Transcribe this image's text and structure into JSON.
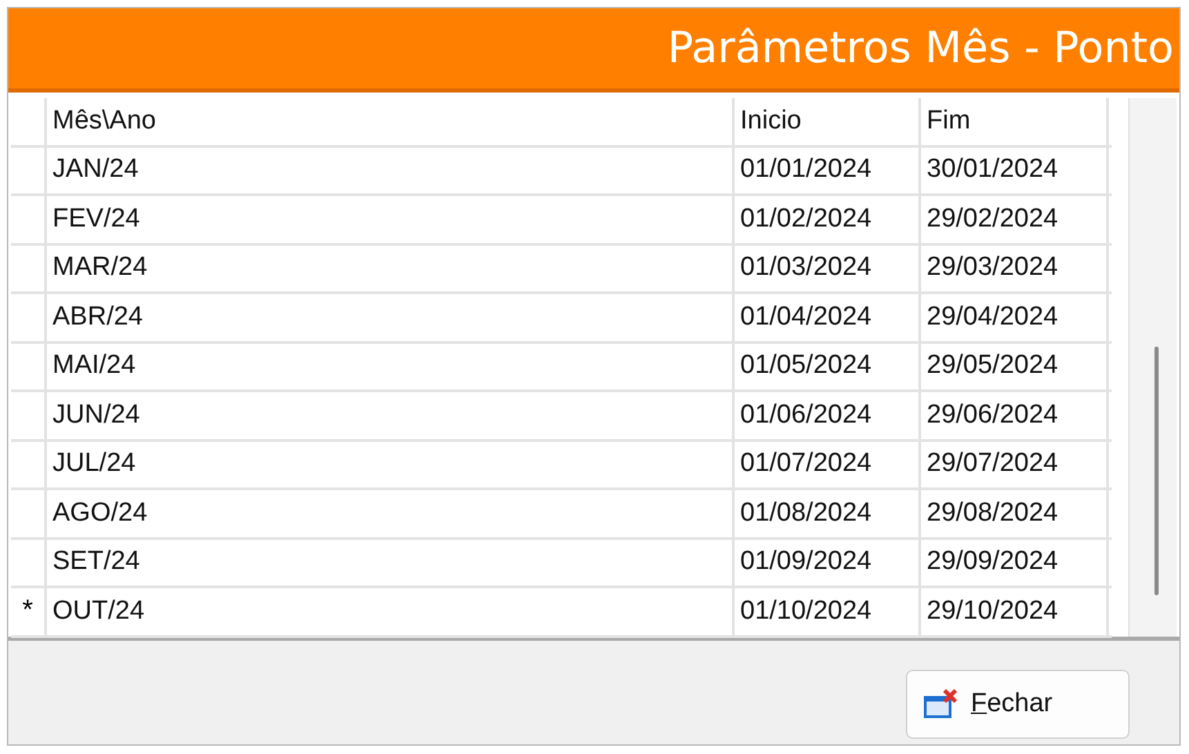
{
  "window": {
    "title": "Parâmetros Mês - Ponto"
  },
  "table": {
    "columns": [
      "Mês\\Ano",
      "Inicio",
      "Fim"
    ],
    "rows": [
      {
        "cells": [
          "JAN/24",
          "01/01/2024",
          "30/01/2024"
        ]
      },
      {
        "cells": [
          "FEV/24",
          "01/02/2024",
          "29/02/2024"
        ]
      },
      {
        "cells": [
          "MAR/24",
          "01/03/2024",
          "29/03/2024"
        ]
      },
      {
        "cells": [
          "ABR/24",
          "01/04/2024",
          "29/04/2024"
        ]
      },
      {
        "cells": [
          "MAI/24",
          "01/05/2024",
          "29/05/2024"
        ]
      },
      {
        "cells": [
          "JUN/24",
          "01/06/2024",
          "29/06/2024"
        ]
      },
      {
        "cells": [
          "JUL/24",
          "01/07/2024",
          "29/07/2024"
        ]
      },
      {
        "cells": [
          "AGO/24",
          "01/08/2024",
          "29/08/2024"
        ]
      },
      {
        "cells": [
          "SET/24",
          "01/09/2024",
          "29/09/2024"
        ]
      },
      {
        "marker": "*",
        "cells": [
          "OUT/24",
          "01/10/2024",
          "29/10/2024"
        ]
      }
    ]
  },
  "buttons": [
    {
      "label": "Fechar"
    }
  ]
}
